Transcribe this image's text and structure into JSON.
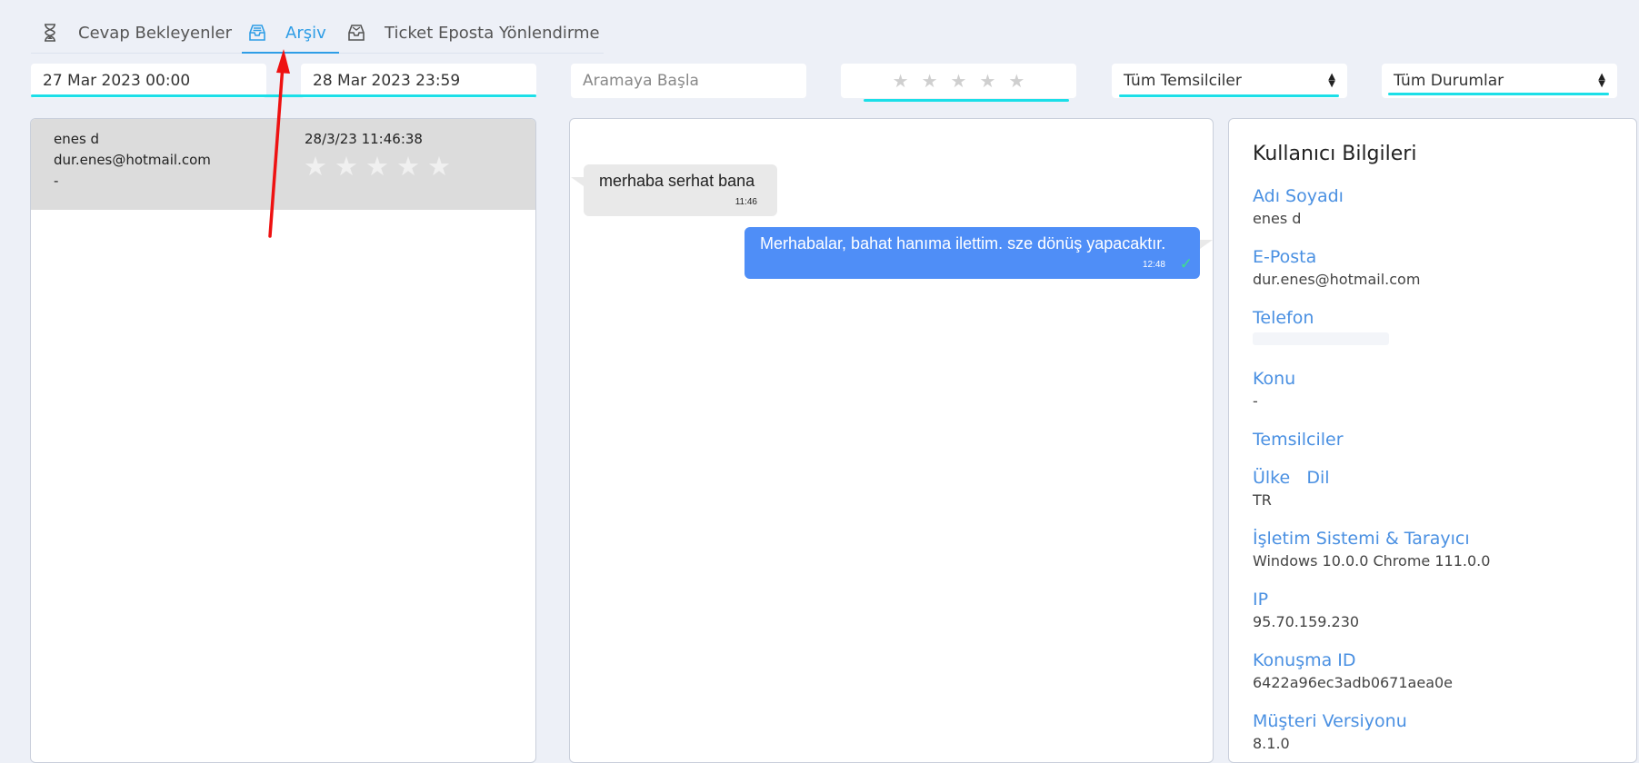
{
  "tabs": [
    {
      "label": "Cevap Bekleyenler",
      "icon": "hourglass-icon",
      "active": false
    },
    {
      "label": "Arşiv",
      "icon": "archive-tray-icon",
      "active": true
    },
    {
      "label": "Ticket Eposta Yönlendirme",
      "icon": "mail-tray-icon",
      "active": false
    }
  ],
  "filters": {
    "date_from": "27 Mar 2023 00:00",
    "date_to": "28 Mar 2023 23:59",
    "search_placeholder": "Aramaya Başla",
    "rating_stars": 5,
    "agent_select": "Tüm Temsilciler",
    "status_select": "Tüm Durumlar"
  },
  "conversations": [
    {
      "name": "enes d",
      "email": "dur.enes@hotmail.com",
      "subject": "-",
      "date": "28/3/23 11:46:38",
      "stars": 5
    }
  ],
  "messages": [
    {
      "direction": "in",
      "text": "merhaba serhat bana",
      "time": "11:46"
    },
    {
      "direction": "out",
      "text": "Merhabalar, bahat hanıma ilettim. sze dönüş yapacaktır.",
      "time": "12:48",
      "status_icon": "check-icon"
    }
  ],
  "user_info": {
    "title": "Kullanıcı Bilgileri",
    "fields": [
      {
        "label": "Adı Soyadı",
        "value": "enes d"
      },
      {
        "label": "E-Posta",
        "value": "dur.enes@hotmail.com"
      },
      {
        "label": "Telefon",
        "value": ""
      },
      {
        "label": "Konu",
        "value": "-"
      },
      {
        "label": "Temsilciler",
        "value": ""
      },
      {
        "label": "Ülke   Dil",
        "value": "TR"
      },
      {
        "label": "İşletim Sistemi & Tarayıcı",
        "value": "Windows 10.0.0 Chrome 111.0.0"
      },
      {
        "label": "IP",
        "value": "95.70.159.230"
      },
      {
        "label": "Konuşma ID",
        "value": "6422a96ec3adb0671aea0e"
      },
      {
        "label": "Müşteri Versiyonu",
        "value": "8.1.0"
      }
    ]
  },
  "colors": {
    "accent": "#2e9de6",
    "label_blue": "#4a90e2",
    "outgoing_bubble": "#4f8ef7",
    "incoming_bubble": "#e9e9e9",
    "highlight_cyan": "#1bdfe8",
    "annotation_arrow": "#ee1111"
  }
}
